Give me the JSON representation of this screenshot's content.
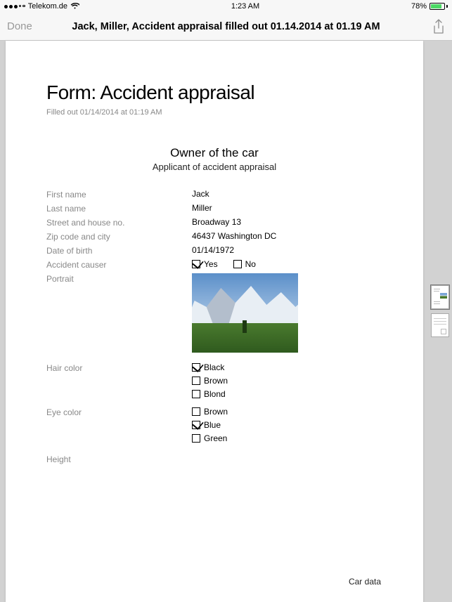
{
  "status": {
    "carrier": "Telekom.de",
    "time": "1:23 AM",
    "battery_pct": "78%"
  },
  "nav": {
    "done": "Done",
    "title": "Jack, Miller, Accident appraisal filled out 01.14.2014 at 01.19 AM"
  },
  "form": {
    "title": "Form: Accident appraisal",
    "subtitle": "Filled out 01/14/2014 at 01:19 AM",
    "section_title": "Owner of the car",
    "section_sub": "Applicant of accident appraisal",
    "labels": {
      "first_name": "First name",
      "last_name": "Last name",
      "street": "Street and house no.",
      "zip_city": "Zip code and city",
      "dob": "Date of birth",
      "causer": "Accident causer",
      "portrait": "Portrait",
      "hair": "Hair color",
      "eye": "Eye color",
      "height": "Height"
    },
    "values": {
      "first_name": "Jack",
      "last_name": "Miller",
      "street": "Broadway 13",
      "zip_city": "46437 Washington DC",
      "dob": "01/14/1972"
    },
    "causer_options": {
      "yes": "Yes",
      "no": "No"
    },
    "causer_checked": "yes",
    "hair_options": [
      "Black",
      "Brown",
      "Blond"
    ],
    "hair_checked": [
      true,
      false,
      false
    ],
    "eye_options": [
      "Brown",
      "Blue",
      "Green"
    ],
    "eye_checked": [
      false,
      true,
      false
    ],
    "footer": "Car data"
  }
}
